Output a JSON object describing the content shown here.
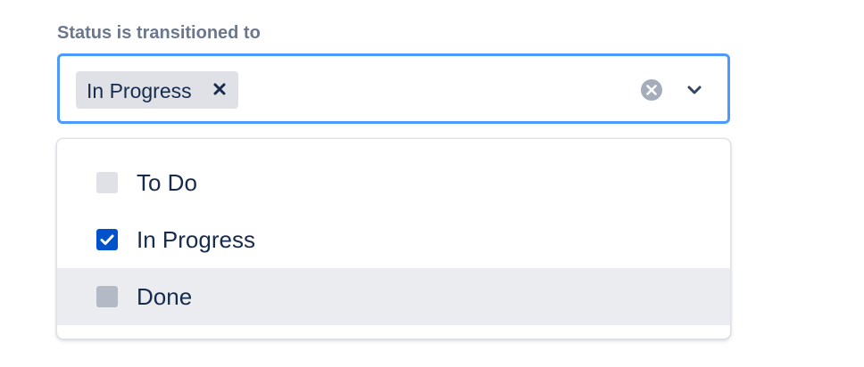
{
  "field": {
    "label": "Status is transitioned to"
  },
  "select": {
    "selected_chips": [
      {
        "label": "In Progress",
        "remove_icon": "close-icon"
      }
    ],
    "clear_icon": "clear-circle-icon",
    "dropdown_icon": "chevron-down-icon",
    "accent_color": "#4c9aff"
  },
  "menu": {
    "options": [
      {
        "label": "To Do",
        "checked": false,
        "focused": false
      },
      {
        "label": "In Progress",
        "checked": true,
        "focused": false
      },
      {
        "label": "Done",
        "checked": false,
        "focused": true
      }
    ],
    "checked_color": "#0052cc",
    "focused_row_color": "#ebecf0"
  }
}
